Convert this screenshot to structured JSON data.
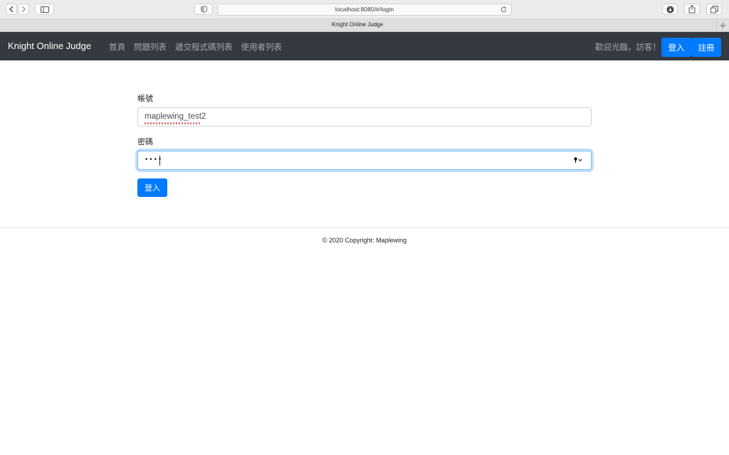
{
  "browser": {
    "url": "localhost:8080/#/login",
    "tab_title": "Knight Online Judge",
    "new_tab_label": "+"
  },
  "navbar": {
    "brand": "Knight Online Judge",
    "links": [
      "首頁",
      "問題列表",
      "遞交程式碼列表",
      "使用者列表"
    ],
    "welcome": "歡迎光臨，訪客！",
    "login_label": "登入",
    "register_label": "註冊"
  },
  "form": {
    "username_label": "帳號",
    "username_value": "maplewing_test2",
    "password_label": "密碼",
    "password_mask": "••••",
    "submit_label": "登入"
  },
  "footer": {
    "text": "© 2020 Copyright: Maplewing"
  },
  "colors": {
    "navbar_bg": "#343a40",
    "primary": "#007bff"
  }
}
